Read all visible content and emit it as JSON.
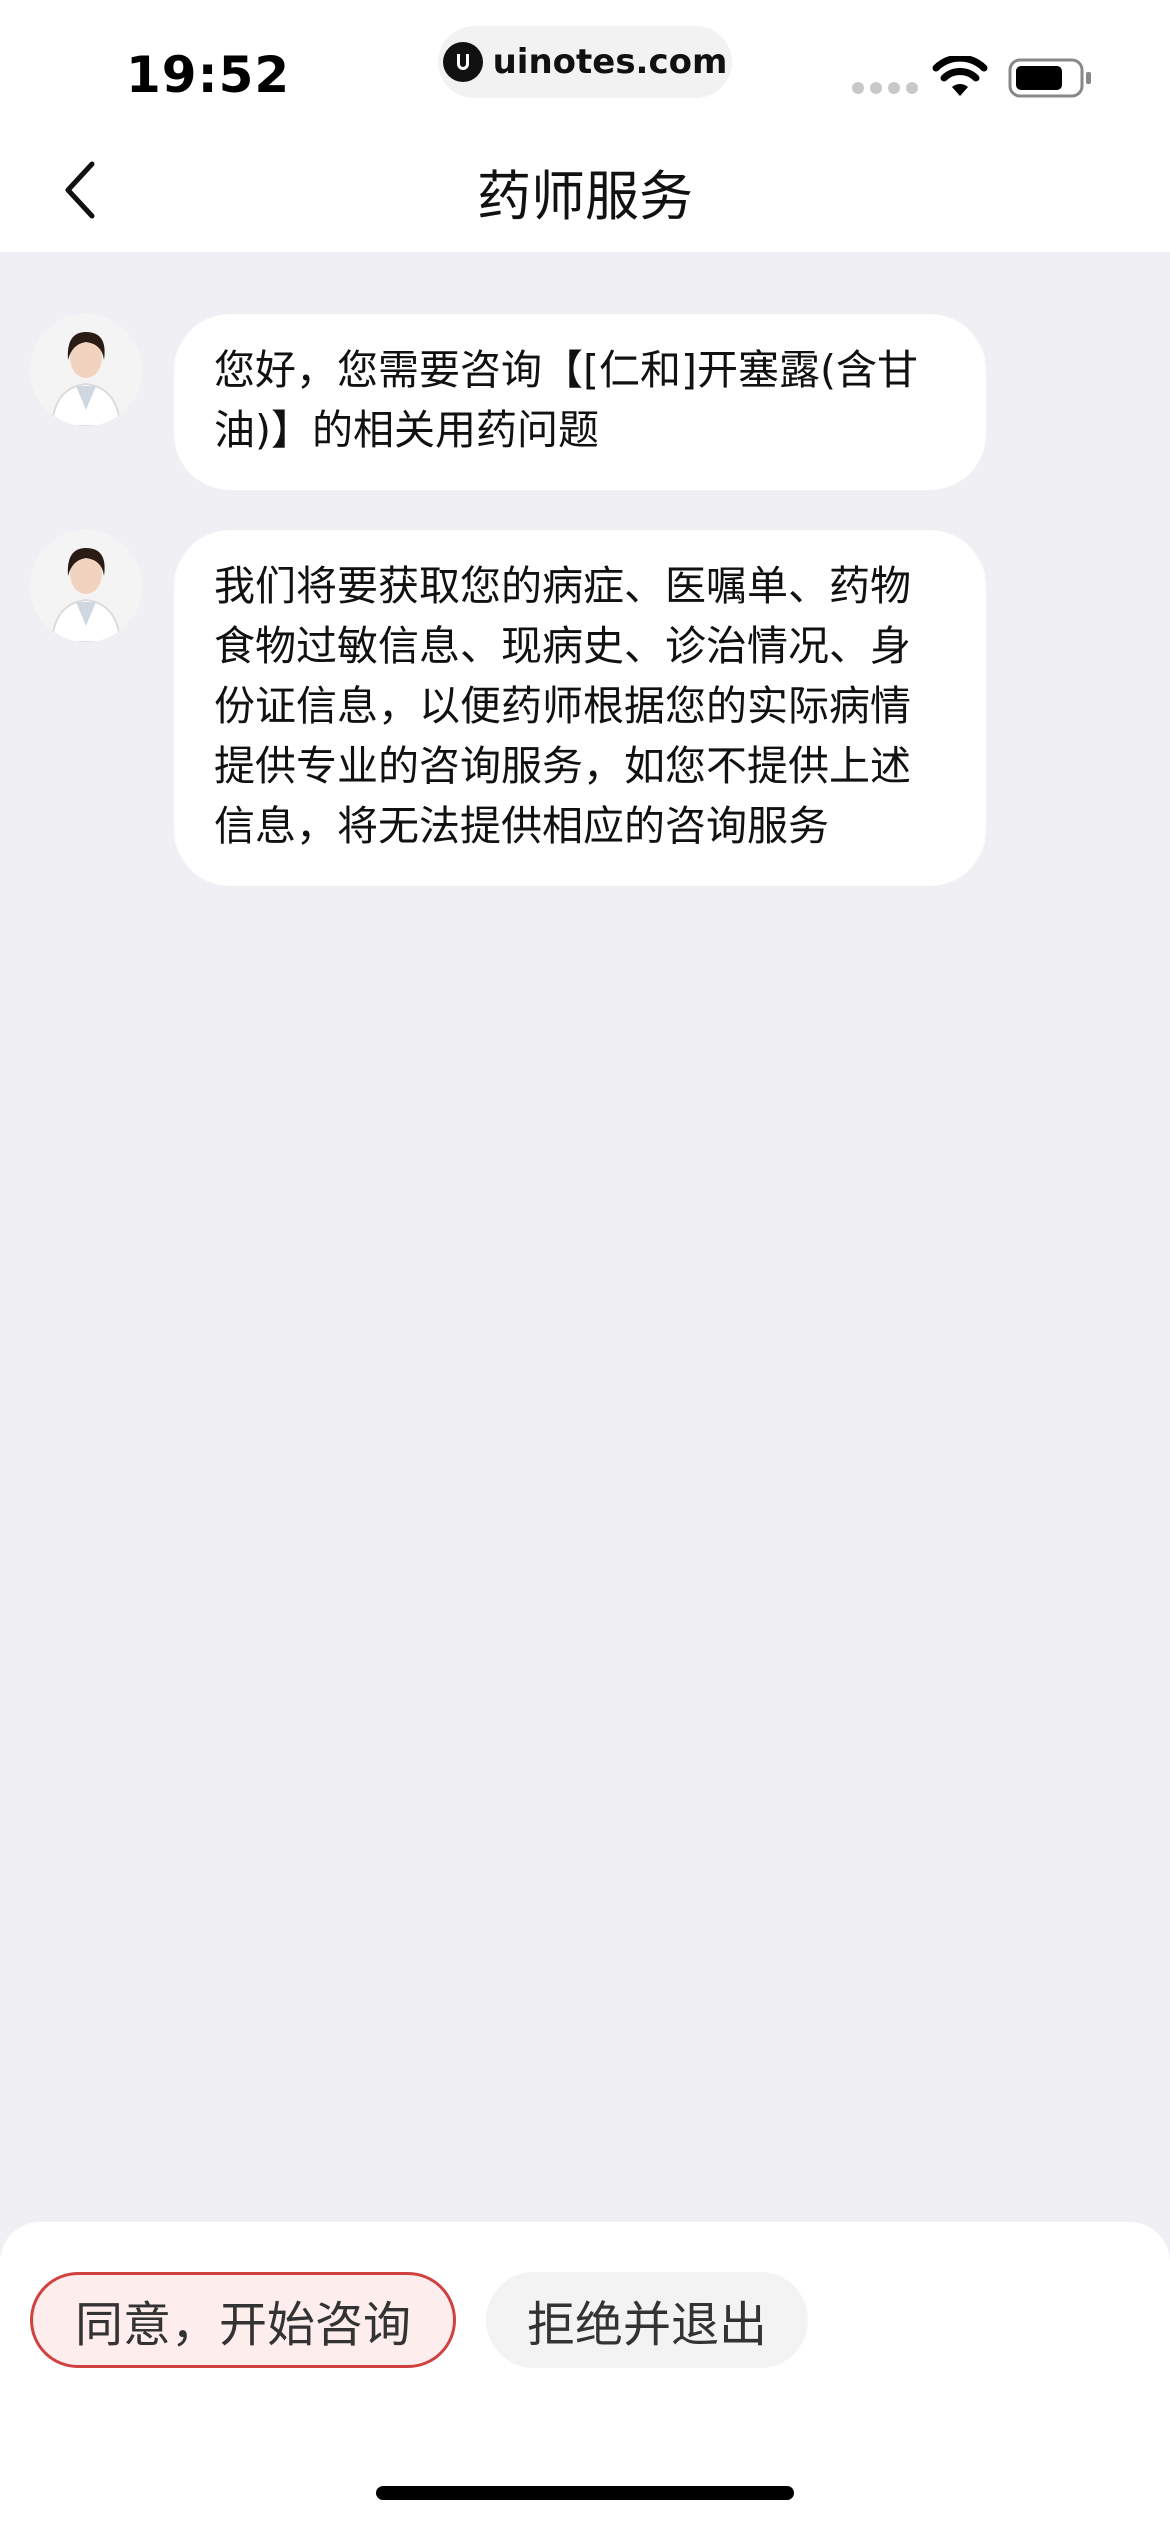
{
  "status_bar": {
    "time": "19:52",
    "url": "uinotes.com"
  },
  "nav": {
    "title": "药师服务",
    "back_icon": "chevron-left-icon"
  },
  "messages": [
    {
      "sender": "pharmacist",
      "text": "您好，您需要咨询【[仁和]开塞露(含甘油)】的相关用药问题"
    },
    {
      "sender": "pharmacist",
      "text": "我们将要获取您的病症、医嘱单、药物食物过敏信息、现病史、诊治情况、身份证信息，以便药师根据您的实际病情提供专业的咨询服务，如您不提供上述信息，将无法提供相应的咨询服务"
    }
  ],
  "actions": {
    "agree_label": "同意，开始咨询",
    "decline_label": "拒绝并退出"
  },
  "colors": {
    "accent": "#d0413f",
    "accent_bg": "#fdeded",
    "chat_bg": "#efeff4"
  }
}
